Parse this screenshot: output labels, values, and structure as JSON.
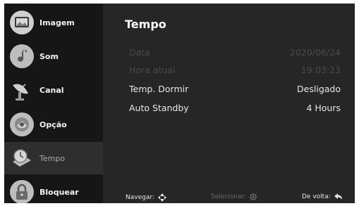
{
  "sidebar": {
    "items": [
      {
        "label": "Imagem",
        "icon": "picture-icon",
        "selected": false
      },
      {
        "label": "Som",
        "icon": "music-note-icon",
        "selected": false
      },
      {
        "label": "Canal",
        "icon": "satellite-dish-icon",
        "selected": false
      },
      {
        "label": "Opção",
        "icon": "options-icon",
        "selected": false
      },
      {
        "label": "Tempo",
        "icon": "clock-icon",
        "selected": true
      },
      {
        "label": "Bloquear",
        "icon": "lock-icon",
        "selected": false
      }
    ]
  },
  "main": {
    "title": "Tempo",
    "settings": [
      {
        "label": "Data",
        "value": "2020/06/24",
        "disabled": true
      },
      {
        "label": "Hora atual",
        "value": "19:03:23",
        "disabled": true
      },
      {
        "label": "Temp. Dormir",
        "value": "Desligado",
        "disabled": false
      },
      {
        "label": "Auto Standby",
        "value": "4 Hours",
        "disabled": false
      }
    ]
  },
  "footer": {
    "navigate": "Navegar:",
    "select": "Selecionar:",
    "back": "De volta:"
  },
  "colors": {
    "background": "#262626",
    "sidebar": "#161616",
    "selected_item": "#2e2e2e",
    "text": "#e8e8e8",
    "disabled_text": "#4a4a4a"
  }
}
